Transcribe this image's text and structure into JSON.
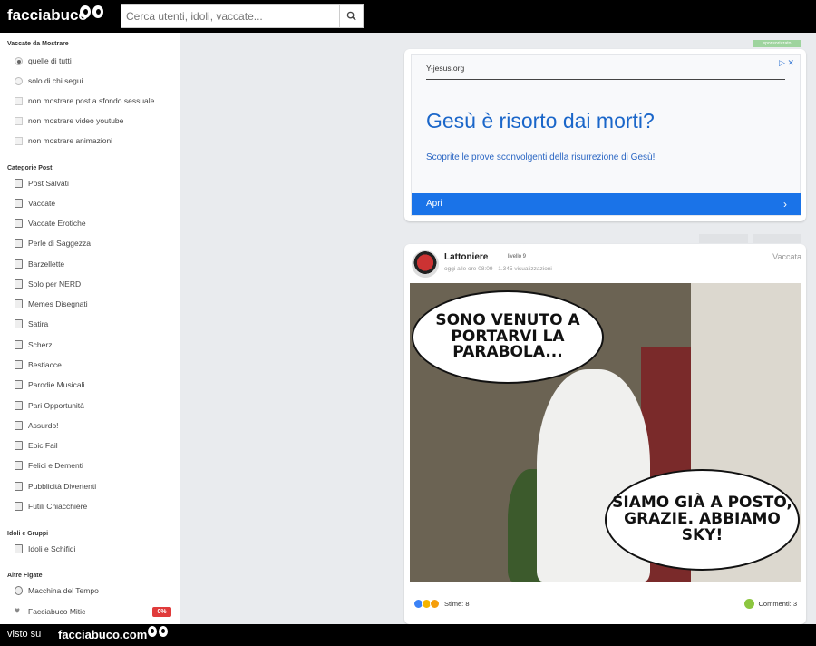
{
  "header": {
    "logo": "facciabuco",
    "search_placeholder": "Cerca utenti, idoli, vaccate..."
  },
  "sidebar": {
    "filter_title": "Vaccate da Mostrare",
    "filters": [
      {
        "label": "quelle di tutti",
        "type": "radio",
        "selected": true
      },
      {
        "label": "solo di chi segui",
        "type": "radio",
        "selected": false
      },
      {
        "label": "non mostrare post a sfondo sessuale",
        "type": "checkbox",
        "checked": false
      },
      {
        "label": "non mostrare video youtube",
        "type": "checkbox",
        "checked": false
      },
      {
        "label": "non mostrare animazioni",
        "type": "checkbox",
        "checked": false
      }
    ],
    "categories_title": "Categorie Post",
    "categories": [
      {
        "label": "Post Salvati",
        "icon": "bookmark-icon"
      },
      {
        "label": "Vaccate",
        "icon": "cow-icon"
      },
      {
        "label": "Vaccate Erotiche",
        "icon": "lips-icon"
      },
      {
        "label": "Perle di Saggezza",
        "icon": "pearl-icon"
      },
      {
        "label": "Barzellette",
        "icon": "joke-icon"
      },
      {
        "label": "Solo per NERD",
        "icon": "controller-icon"
      },
      {
        "label": "Memes Disegnati",
        "icon": "meme-icon"
      },
      {
        "label": "Satira",
        "icon": "mask-icon"
      },
      {
        "label": "Scherzi",
        "icon": "prank-icon"
      },
      {
        "label": "Bestiacce",
        "icon": "animal-icon"
      },
      {
        "label": "Parodie Musicali",
        "icon": "music-icon"
      },
      {
        "label": "Pari Opportunità",
        "icon": "equality-icon"
      },
      {
        "label": "Assurdo!",
        "icon": "absurd-icon"
      },
      {
        "label": "Epic Fail",
        "icon": "fail-icon"
      },
      {
        "label": "Felici e Dementi",
        "icon": "happy-icon"
      },
      {
        "label": "Pubblicità Divertenti",
        "icon": "ad-icon"
      },
      {
        "label": "Futili Chiacchiere",
        "icon": "chat-icon"
      }
    ],
    "idols_title": "Idoli e Gruppi",
    "idols": [
      {
        "label": "Idoli e Schifidi",
        "icon": "trophy-icon"
      }
    ],
    "other_title": "Altre Figate",
    "other": [
      {
        "label": "Macchina del Tempo",
        "icon": "clock-icon"
      },
      {
        "label": "Facciabuco Mitic",
        "icon": "heart-icon",
        "badge": "0%"
      }
    ]
  },
  "ad": {
    "label": "sponsorizzato",
    "url": "Y-jesus.org",
    "headline": "Gesù è risorto dai morti?",
    "subtitle": "Scoprite le prove sconvolgenti della risurrezione di Gesù!",
    "button": "Apri",
    "close": "▷ ✕"
  },
  "post": {
    "username": "Lattoniere",
    "level": "livello 9",
    "meta": "oggi alle ore 08:09 - 1.345 visualizzazioni",
    "type": "Vaccata",
    "bubble_top": "SONO VENUTO A PORTARVI LA PARABOLA...",
    "bubble_bottom": "SIAMO GIÀ A POSTO, GRAZIE. ABBIAMO SKY!",
    "likes": "Stime: 8",
    "comments": "Commenti: 3"
  },
  "footer": {
    "seen_on": "visto su",
    "brand": "facciabuco.com"
  }
}
